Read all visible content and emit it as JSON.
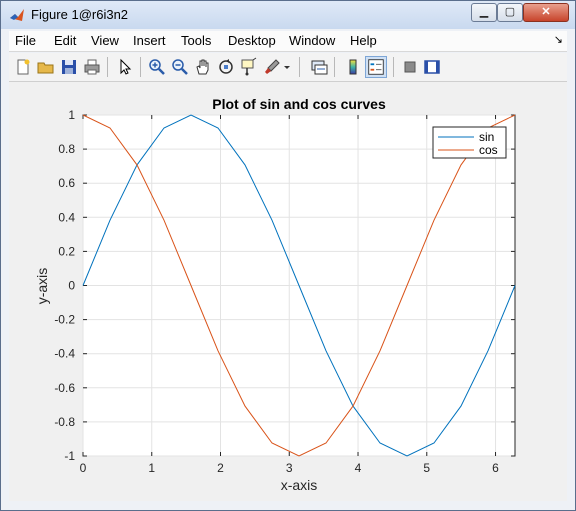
{
  "window": {
    "title": "Figure 1@r6i3n2"
  },
  "menu": [
    "File",
    "Edit",
    "View",
    "Insert",
    "Tools",
    "Desktop",
    "Window",
    "Help"
  ],
  "toolbar": [
    "new-figure-icon",
    "open-file-icon",
    "save-icon",
    "print-icon",
    "pointer-icon",
    "zoom-in-icon",
    "zoom-out-icon",
    "pan-icon",
    "rotate-3d-icon",
    "data-cursor-icon",
    "brush-icon",
    "link-plot-icon",
    "colorbar-icon",
    "legend-icon",
    "hide-plot-tools-icon",
    "show-plot-tools-icon"
  ],
  "chart_data": {
    "type": "line",
    "title": "Plot of sin and cos curves",
    "xlabel": "x-axis",
    "ylabel": "y-axis",
    "xlim": [
      0,
      6.2832
    ],
    "ylim": [
      -1,
      1
    ],
    "xticks": [
      "0",
      "1",
      "2",
      "3",
      "4",
      "5",
      "6"
    ],
    "yticks": [
      "1",
      "0.8",
      "0.6",
      "0.4",
      "0.2",
      "0",
      "-0.2",
      "-0.4",
      "-0.6",
      "-0.8",
      "-1"
    ],
    "grid": true,
    "legend_position": "top-right",
    "x": [
      0,
      0.3927,
      0.7854,
      1.1781,
      1.5708,
      1.9635,
      2.3562,
      2.7489,
      3.1416,
      3.5343,
      3.927,
      4.3197,
      4.7124,
      5.1051,
      5.4978,
      5.8905,
      6.2832
    ],
    "series": [
      {
        "name": "sin",
        "color": "#0072bd",
        "values": [
          0,
          0.3827,
          0.7071,
          0.9239,
          1,
          0.9239,
          0.7071,
          0.3827,
          0,
          -0.3827,
          -0.7071,
          -0.9239,
          -1,
          -0.9239,
          -0.7071,
          -0.3827,
          0
        ]
      },
      {
        "name": "cos",
        "color": "#d95319",
        "values": [
          1,
          0.9239,
          0.7071,
          0.3827,
          0,
          -0.3827,
          -0.7071,
          -0.9239,
          -1,
          -0.9239,
          -0.7071,
          -0.3827,
          0,
          0.3827,
          0.7071,
          0.9239,
          1
        ]
      }
    ]
  }
}
